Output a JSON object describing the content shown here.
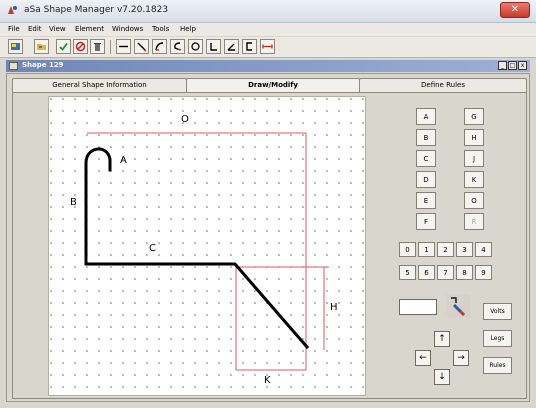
{
  "window": {
    "title": "aSa Shape Manager v7.20.1823",
    "close_label": "✕"
  },
  "menubar": {
    "items": [
      "File",
      "Edit",
      "View",
      "Element",
      "Windows",
      "Tools",
      "Help"
    ]
  },
  "toolbar": {
    "icons": [
      "open-icon",
      "folder-icon",
      "check-icon",
      "no-icon",
      "trash-icon",
      "line-icon",
      "slash-icon",
      "curve-icon",
      "hook-icon",
      "circle-icon",
      "corner-icon",
      "angle-icon",
      "bracket-icon",
      "dimension-icon"
    ]
  },
  "inner_window": {
    "title": "Shape 129",
    "controls": [
      "_",
      "□",
      "x"
    ]
  },
  "tabs": [
    {
      "label": "General Shape Information"
    },
    {
      "label": "Draw/Modify"
    },
    {
      "label": "Define Rules"
    }
  ],
  "canvas": {
    "labels": {
      "a": "A",
      "b": "B",
      "c": "C",
      "o": "O",
      "h": "H",
      "k": "K"
    }
  },
  "letter_buttons": {
    "left": [
      "A",
      "B",
      "C",
      "D",
      "E",
      "F"
    ],
    "right": [
      "G",
      "H",
      "J",
      "K",
      "O",
      "R"
    ]
  },
  "number_buttons": {
    "row1": [
      "0",
      "1",
      "2",
      "3",
      "4"
    ],
    "row2": [
      "5",
      "6",
      "7",
      "8",
      "9"
    ]
  },
  "side_buttons": {
    "volts": "Volts",
    "legs": "Legs",
    "rules": "Rules"
  },
  "arrows": {
    "up": "↑",
    "left": "←",
    "right": "→",
    "down": "↓"
  },
  "colors": {
    "dimension": "#e05a5a",
    "shape": "#000000"
  }
}
